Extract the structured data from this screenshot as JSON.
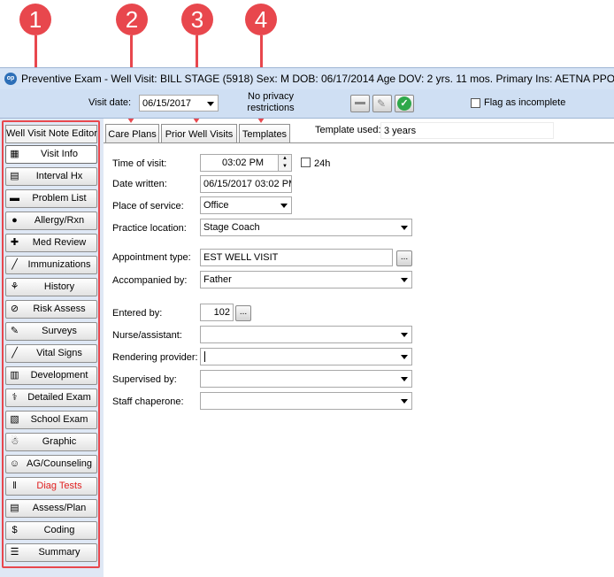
{
  "callouts": [
    "1",
    "2",
    "3",
    "4"
  ],
  "titlebar": {
    "logo": "op",
    "title": "Preventive Exam - Well Visit:  BILL STAGE (5918)   Sex: M   DOB: 06/17/2014   Age DOV: 2 yrs. 11 mos.   Primary Ins: AETNA PPO"
  },
  "formbar": {
    "visit_date_label": "Visit date:",
    "visit_date": "06/15/2017",
    "privacy_line1": "No privacy",
    "privacy_line2": "restrictions",
    "flag_label": "Flag as incomplete"
  },
  "nav": {
    "header": "Well Visit Note Editor",
    "items": [
      {
        "label": "Visit Info",
        "icon": "calendar-icon",
        "glyph": "▦"
      },
      {
        "label": "Interval Hx",
        "icon": "document-icon",
        "glyph": "▤"
      },
      {
        "label": "Problem List",
        "icon": "list-icon",
        "glyph": "▬"
      },
      {
        "label": "Allergy/Rxn",
        "icon": "allergy-icon",
        "glyph": "●"
      },
      {
        "label": "Med Review",
        "icon": "medication-icon",
        "glyph": "✚"
      },
      {
        "label": "Immunizations",
        "icon": "syringe-icon",
        "glyph": "╱"
      },
      {
        "label": "History",
        "icon": "family-tree-icon",
        "glyph": "⚘"
      },
      {
        "label": "Risk Assess",
        "icon": "no-smoking-icon",
        "glyph": "⊘"
      },
      {
        "label": "Surveys",
        "icon": "survey-icon",
        "glyph": "✎"
      },
      {
        "label": "Vital Signs",
        "icon": "thermometer-icon",
        "glyph": "╱"
      },
      {
        "label": "Development",
        "icon": "development-icon",
        "glyph": "▥"
      },
      {
        "label": "Detailed Exam",
        "icon": "stethoscope-icon",
        "glyph": "⚕"
      },
      {
        "label": "School Exam",
        "icon": "school-book-icon",
        "glyph": "▧"
      },
      {
        "label": "Graphic",
        "icon": "body-figure-icon",
        "glyph": "☃"
      },
      {
        "label": "AG/Counseling",
        "icon": "counseling-icon",
        "glyph": "☺"
      },
      {
        "label": "Diag Tests",
        "icon": "test-tubes-icon",
        "glyph": "‖"
      },
      {
        "label": "Assess/Plan",
        "icon": "book-icon",
        "glyph": "▤"
      },
      {
        "label": "Coding",
        "icon": "dollar-icon",
        "glyph": "$"
      },
      {
        "label": "Summary",
        "icon": "summary-icon",
        "glyph": "☰"
      }
    ]
  },
  "tabs": [
    "Care Plans",
    "Prior Well Visits",
    "Templates"
  ],
  "template_used_label": "Template used:",
  "template_used_value": "3 years",
  "form": {
    "time_of_visit_label": "Time of visit:",
    "time_of_visit": "03:02 PM",
    "h24_label": "24h",
    "date_written_label": "Date written:",
    "date_written": "06/15/2017 03:02 PM",
    "place_of_service_label": "Place of service:",
    "place_of_service": "Office",
    "practice_location_label": "Practice location:",
    "practice_location": "Stage Coach",
    "appointment_type_label": "Appointment type:",
    "appointment_type": "EST WELL VISIT",
    "accompanied_by_label": "Accompanied by:",
    "accompanied_by": "Father",
    "entered_by_label": "Entered by:",
    "entered_by": "102",
    "nurse_label": "Nurse/assistant:",
    "nurse": "",
    "rendering_provider_label": "Rendering provider:",
    "rendering_provider": "",
    "supervised_by_label": "Supervised by:",
    "supervised_by": "",
    "staff_chaperone_label": "Staff chaperone:",
    "staff_chaperone": ""
  },
  "colors": {
    "callout": "#e8474d",
    "titlebar": "#d5e3f5",
    "diag_tests_text": "#e02020",
    "ok_button": "#2ea84a"
  }
}
